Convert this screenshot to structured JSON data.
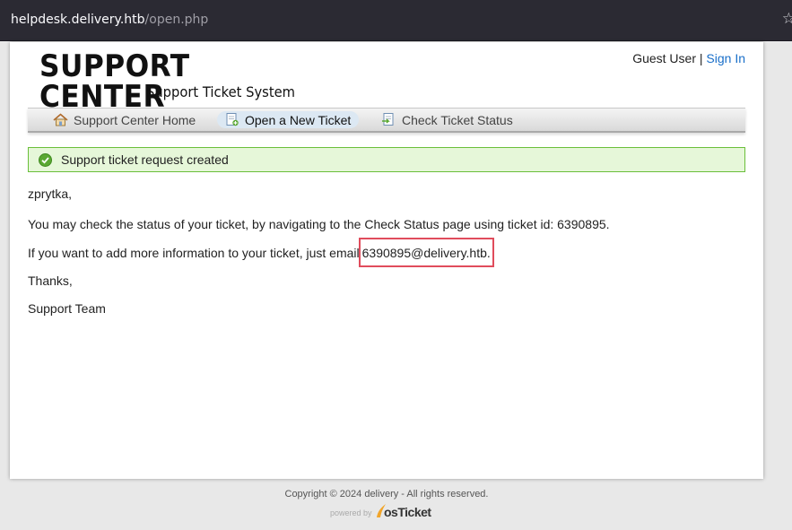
{
  "browser": {
    "url_host": "helpdesk.delivery.htb",
    "url_path": "/open.php"
  },
  "header": {
    "logo_title": "SUPPORT CENTER",
    "logo_subtitle": "Support Ticket System",
    "guest_label": "Guest User |",
    "sign_in": "Sign In"
  },
  "nav": {
    "items": [
      {
        "label": "Support Center Home",
        "icon": "home-icon"
      },
      {
        "label": "Open a New Ticket",
        "icon": "new-ticket-icon"
      },
      {
        "label": "Check Ticket Status",
        "icon": "ticket-status-icon"
      }
    ],
    "active_index": 1
  },
  "notice": {
    "text": "Support ticket request created",
    "icon": "success-check-icon",
    "color": "#6abf3a"
  },
  "message": {
    "greeting": "zprytka,",
    "status_line": "You may check the status of your ticket, by navigating to the Check Status page using ticket id: 6390895.",
    "email_line_prefix": "If you want to add more information to your ticket, just email",
    "email_address": "6390895@delivery.htb.",
    "thanks": "Thanks,",
    "signoff": "Support Team"
  },
  "footer": {
    "copyright": "Copyright © 2024 delivery - All rights reserved.",
    "powered_by": "powered by",
    "brand": "osTicket"
  },
  "colors": {
    "link": "#1a6fc9",
    "highlight_border": "#e04c5c",
    "notice_bg": "#e6f7d9",
    "topbar": "#2b2a33"
  }
}
